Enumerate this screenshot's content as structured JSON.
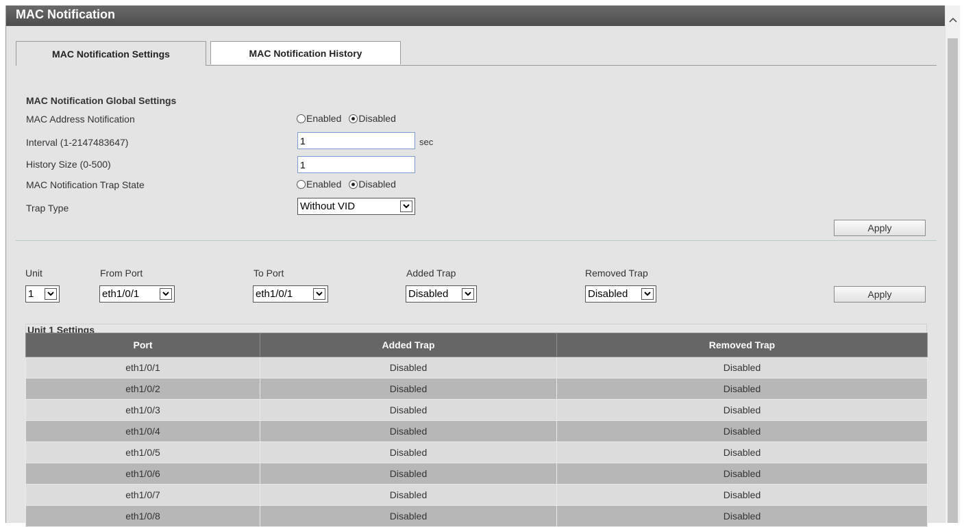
{
  "page_title": "MAC Notification",
  "tabs": [
    {
      "label": "MAC Notification Settings",
      "active": true
    },
    {
      "label": "MAC Notification History",
      "active": false
    }
  ],
  "global": {
    "section_title": "MAC Notification Global Settings",
    "mac_address_notification": {
      "label": "MAC Address Notification",
      "enabled_label": "Enabled",
      "disabled_label": "Disabled",
      "selected": "Disabled"
    },
    "interval": {
      "label": "Interval (1-2147483647)",
      "value": "1",
      "unit": "sec"
    },
    "history_size": {
      "label": "History Size (0-500)",
      "value": "1"
    },
    "trap_state": {
      "label": "MAC Notification Trap State",
      "enabled_label": "Enabled",
      "disabled_label": "Disabled",
      "selected": "Disabled"
    },
    "trap_type": {
      "label": "Trap Type",
      "value": "Without VID"
    },
    "apply_label": "Apply"
  },
  "port_settings": {
    "unit": {
      "label": "Unit",
      "value": "1"
    },
    "from_port": {
      "label": "From Port",
      "value": "eth1/0/1"
    },
    "to_port": {
      "label": "To Port",
      "value": "eth1/0/1"
    },
    "added_trap": {
      "label": "Added Trap",
      "value": "Disabled"
    },
    "removed_trap": {
      "label": "Removed Trap",
      "value": "Disabled"
    },
    "apply_label": "Apply"
  },
  "unit_table": {
    "title": "Unit 1 Settings",
    "columns": [
      "Port",
      "Added Trap",
      "Removed Trap"
    ],
    "rows": [
      [
        "eth1/0/1",
        "Disabled",
        "Disabled"
      ],
      [
        "eth1/0/2",
        "Disabled",
        "Disabled"
      ],
      [
        "eth1/0/3",
        "Disabled",
        "Disabled"
      ],
      [
        "eth1/0/4",
        "Disabled",
        "Disabled"
      ],
      [
        "eth1/0/5",
        "Disabled",
        "Disabled"
      ],
      [
        "eth1/0/6",
        "Disabled",
        "Disabled"
      ],
      [
        "eth1/0/7",
        "Disabled",
        "Disabled"
      ],
      [
        "eth1/0/8",
        "Disabled",
        "Disabled"
      ]
    ]
  }
}
